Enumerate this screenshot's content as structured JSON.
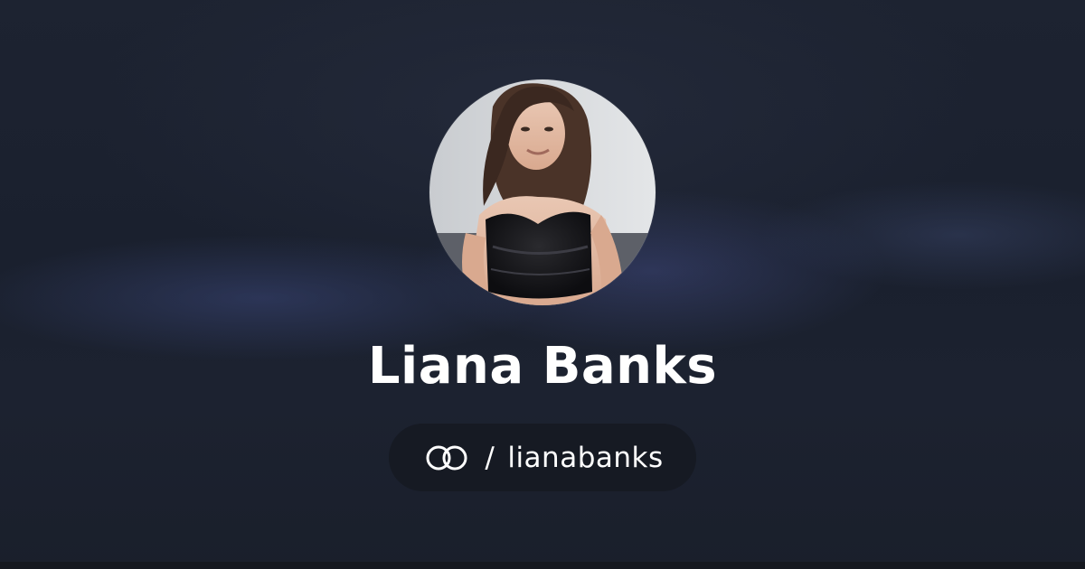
{
  "profile": {
    "name": "Liana Banks",
    "separator": "/",
    "username": "lianabanks",
    "avatar_alt": "Liana Banks"
  },
  "icons": {
    "brand": "linked-rings-logo-icon"
  },
  "colors": {
    "background": "#1b2130",
    "pill_background": "#161a23",
    "text": "#ffffff"
  }
}
